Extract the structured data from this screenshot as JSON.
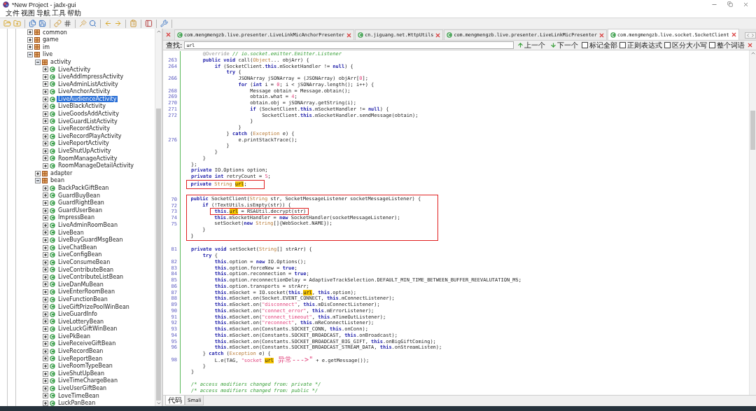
{
  "window": {
    "title": "*New Project - jadx-gui"
  },
  "menu": [
    "文件",
    "视图",
    "导航",
    "工具",
    "帮助"
  ],
  "tree": [
    {
      "label": "common",
      "kind": "package",
      "expanded": false,
      "selected": false
    },
    {
      "label": "game",
      "kind": "package",
      "expanded": false,
      "selected": false
    },
    {
      "label": "im",
      "kind": "package",
      "expanded": false,
      "selected": false
    },
    {
      "label": "live",
      "kind": "package",
      "expanded": true,
      "selected": false,
      "children": [
        {
          "label": "activity",
          "kind": "package",
          "expanded": true,
          "selected": false,
          "children": [
            {
              "label": "LiveActivity",
              "kind": "class",
              "expanded": false,
              "selected": false
            },
            {
              "label": "LiveAddImpressActivity",
              "kind": "class",
              "expanded": false,
              "selected": false
            },
            {
              "label": "LiveAdminListActivity",
              "kind": "class",
              "expanded": false,
              "selected": false
            },
            {
              "label": "LiveAnchorActivity",
              "kind": "class",
              "expanded": false,
              "selected": false
            },
            {
              "label": "LiveAudienceActivity",
              "kind": "class",
              "expanded": false,
              "selected": true
            },
            {
              "label": "LiveBlackActivity",
              "kind": "class",
              "expanded": false,
              "selected": false
            },
            {
              "label": "LiveGoodsAddActivity",
              "kind": "class",
              "expanded": false,
              "selected": false
            },
            {
              "label": "LiveGuardListActivity",
              "kind": "class",
              "expanded": false,
              "selected": false
            },
            {
              "label": "LiveRecordActivity",
              "kind": "class",
              "expanded": false,
              "selected": false
            },
            {
              "label": "LiveRecordPlayActivity",
              "kind": "class",
              "expanded": false,
              "selected": false
            },
            {
              "label": "LiveReportActivity",
              "kind": "class",
              "expanded": false,
              "selected": false
            },
            {
              "label": "LiveShutUpActivity",
              "kind": "class",
              "expanded": false,
              "selected": false
            },
            {
              "label": "RoomManageActivity",
              "kind": "class",
              "expanded": false,
              "selected": false
            },
            {
              "label": "RoomManageDetailActivity",
              "kind": "class",
              "expanded": false,
              "selected": false
            }
          ]
        },
        {
          "label": "adapter",
          "kind": "package",
          "expanded": false,
          "selected": false
        },
        {
          "label": "bean",
          "kind": "package",
          "expanded": true,
          "selected": false,
          "children": [
            {
              "label": "BackPackGiftBean",
              "kind": "class",
              "expanded": false,
              "selected": false
            },
            {
              "label": "GuardBuyBean",
              "kind": "class",
              "expanded": false,
              "selected": false
            },
            {
              "label": "GuardRightBean",
              "kind": "class",
              "expanded": false,
              "selected": false
            },
            {
              "label": "GuardUserBean",
              "kind": "class",
              "expanded": false,
              "selected": false
            },
            {
              "label": "ImpressBean",
              "kind": "class",
              "expanded": false,
              "selected": false
            },
            {
              "label": "LiveAdminRoomBean",
              "kind": "class",
              "expanded": false,
              "selected": false
            },
            {
              "label": "LiveBean",
              "kind": "class",
              "expanded": false,
              "selected": false
            },
            {
              "label": "LiveBuyGuardMsgBean",
              "kind": "class",
              "expanded": false,
              "selected": false
            },
            {
              "label": "LiveChatBean",
              "kind": "class",
              "expanded": false,
              "selected": false
            },
            {
              "label": "LiveConfigBean",
              "kind": "class",
              "expanded": false,
              "selected": false
            },
            {
              "label": "LiveConsumeBean",
              "kind": "class",
              "expanded": false,
              "selected": false
            },
            {
              "label": "LiveContributeBean",
              "kind": "class",
              "expanded": false,
              "selected": false
            },
            {
              "label": "LiveContributeListBean",
              "kind": "class",
              "expanded": false,
              "selected": false
            },
            {
              "label": "LiveDanMuBean",
              "kind": "class",
              "expanded": false,
              "selected": false
            },
            {
              "label": "LiveEnterRoomBean",
              "kind": "class",
              "expanded": false,
              "selected": false
            },
            {
              "label": "LiveFunctionBean",
              "kind": "class",
              "expanded": false,
              "selected": false
            },
            {
              "label": "LiveGiftPrizePoolWinBean",
              "kind": "class",
              "expanded": false,
              "selected": false
            },
            {
              "label": "LiveGuardInfo",
              "kind": "class",
              "expanded": false,
              "selected": false
            },
            {
              "label": "LiveLotteryBean",
              "kind": "class",
              "expanded": false,
              "selected": false
            },
            {
              "label": "LiveLuckGiftWinBean",
              "kind": "class",
              "expanded": false,
              "selected": false
            },
            {
              "label": "LivePkBean",
              "kind": "class",
              "expanded": false,
              "selected": false
            },
            {
              "label": "LiveReceiveGiftBean",
              "kind": "class",
              "expanded": false,
              "selected": false
            },
            {
              "label": "LiveRecordBean",
              "kind": "class",
              "expanded": false,
              "selected": false
            },
            {
              "label": "LiveReportBean",
              "kind": "class",
              "expanded": false,
              "selected": false
            },
            {
              "label": "LiveRoomTypeBean",
              "kind": "class",
              "expanded": false,
              "selected": false
            },
            {
              "label": "LiveShutUpBean",
              "kind": "class",
              "expanded": false,
              "selected": false
            },
            {
              "label": "LiveTimeChargeBean",
              "kind": "class",
              "expanded": false,
              "selected": false
            },
            {
              "label": "LiveUserGiftBean",
              "kind": "class",
              "expanded": false,
              "selected": false
            },
            {
              "label": "LoveTimeBean",
              "kind": "class",
              "expanded": false,
              "selected": false
            },
            {
              "label": "LuckPanBean",
              "kind": "class",
              "expanded": false,
              "selected": false
            }
          ]
        }
      ]
    }
  ],
  "tabs": [
    {
      "label": "com.mengmengzb.live.presenter.LiveLinkMicAnchorPresenter",
      "selected": false
    },
    {
      "label": "cn.jiguang.net.HttpUtils",
      "selected": false
    },
    {
      "label": "com.mengmengzb.live.presenter.LiveLinkMicPresenter",
      "selected": false
    },
    {
      "label": "com.mengmengzb.live.socket.SocketClient",
      "selected": true
    }
  ],
  "search": {
    "label": "查找:",
    "value": "url",
    "previous": "上一个",
    "next": "下一个",
    "options": [
      {
        "label": "标记全部",
        "checked": false
      },
      {
        "label": "正则表达式",
        "checked": false
      },
      {
        "label": "区分大小写",
        "checked": false
      },
      {
        "label": "整个词语",
        "checked": false
      }
    ]
  },
  "code": [
    {
      "boxed": false,
      "lines": [
        {
          "kind": "code",
          "segments": [
            {
              "kind": "annotation",
              "text": "    @Override"
            },
            {
              "kind": "comment",
              "text": " // io.socket.emitter.Emitter.Listener"
            }
          ]
        },
        {
          "kind": "code",
          "number": "263",
          "segments": [
            {
              "kind": "keyword",
              "text": "    public void"
            },
            {
              "kind": "plain",
              "text": " call("
            },
            {
              "kind": "type",
              "text": "Object"
            },
            {
              "kind": "plain",
              "text": "... objArr) {"
            }
          ]
        },
        {
          "kind": "code",
          "number": "264",
          "segments": [
            {
              "kind": "keyword",
              "text": "        if"
            },
            {
              "kind": "plain",
              "text": " (SocketClient."
            },
            {
              "kind": "keyword",
              "text": "this"
            },
            {
              "kind": "plain",
              "text": ".mSocketHandler != "
            },
            {
              "kind": "keyword",
              "text": "null"
            },
            {
              "kind": "plain",
              "text": ") {"
            }
          ]
        },
        {
          "kind": "code",
          "segments": [
            {
              "kind": "keyword",
              "text": "            try"
            },
            {
              "kind": "plain",
              "text": " {"
            }
          ]
        },
        {
          "kind": "code",
          "number": "266",
          "segments": [
            {
              "kind": "plain",
              "text": "                JSONArray jSONArray = (JSONArray) objArr["
            },
            {
              "kind": "number",
              "text": "0"
            },
            {
              "kind": "plain",
              "text": "];"
            }
          ]
        },
        {
          "kind": "code",
          "segments": [
            {
              "kind": "keyword",
              "text": "                for"
            },
            {
              "kind": "plain",
              "text": " ("
            },
            {
              "kind": "keyword",
              "text": "int"
            },
            {
              "kind": "plain",
              "text": " i = "
            },
            {
              "kind": "number",
              "text": "0"
            },
            {
              "kind": "plain",
              "text": "; i < jSONArray.length(); i++) {"
            }
          ]
        },
        {
          "kind": "code",
          "number": "268",
          "segments": [
            {
              "kind": "plain",
              "text": "                    Message obtain = Message.obtain();"
            }
          ]
        },
        {
          "kind": "code",
          "number": "269",
          "segments": [
            {
              "kind": "plain",
              "text": "                    obtain.what = "
            },
            {
              "kind": "number",
              "text": "4"
            },
            {
              "kind": "plain",
              "text": ";"
            }
          ]
        },
        {
          "kind": "code",
          "number": "270",
          "segments": [
            {
              "kind": "plain",
              "text": "                    obtain.obj = jSONArray.getString(i);"
            }
          ]
        },
        {
          "kind": "code",
          "number": "271",
          "segments": [
            {
              "kind": "keyword",
              "text": "                    if"
            },
            {
              "kind": "plain",
              "text": " (SocketClient."
            },
            {
              "kind": "keyword",
              "text": "this"
            },
            {
              "kind": "plain",
              "text": ".mSocketHandler != "
            },
            {
              "kind": "keyword",
              "text": "null"
            },
            {
              "kind": "plain",
              "text": ") {"
            }
          ]
        },
        {
          "kind": "code",
          "number": "272",
          "segments": [
            {
              "kind": "plain",
              "text": "                        SocketClient."
            },
            {
              "kind": "keyword",
              "text": "this"
            },
            {
              "kind": "plain",
              "text": ".mSocketHandler.sendMessage(obtain);"
            }
          ]
        },
        {
          "kind": "code",
          "segments": [
            {
              "kind": "plain",
              "text": "                    }"
            }
          ]
        },
        {
          "kind": "code",
          "segments": [
            {
              "kind": "plain",
              "text": "                }"
            }
          ]
        },
        {
          "kind": "code",
          "segments": [
            {
              "kind": "plain",
              "text": "            } "
            },
            {
              "kind": "keyword",
              "text": "catch"
            },
            {
              "kind": "plain",
              "text": " ("
            },
            {
              "kind": "type",
              "text": "Exception"
            },
            {
              "kind": "plain",
              "text": " e) {"
            }
          ]
        },
        {
          "kind": "code",
          "number": "276",
          "segments": [
            {
              "kind": "plain",
              "text": "                e.printStackTrace();"
            }
          ]
        },
        {
          "kind": "code",
          "segments": [
            {
              "kind": "plain",
              "text": "            }"
            }
          ]
        },
        {
          "kind": "code",
          "segments": [
            {
              "kind": "plain",
              "text": "        }"
            }
          ]
        },
        {
          "kind": "code",
          "segments": [
            {
              "kind": "plain",
              "text": "    }"
            }
          ]
        },
        {
          "kind": "code",
          "segments": [
            {
              "kind": "plain",
              "text": "};"
            }
          ]
        },
        {
          "kind": "code",
          "segments": [
            {
              "kind": "keyword",
              "text": "private"
            },
            {
              "kind": "plain",
              "text": " IO.Options option;"
            }
          ]
        },
        {
          "kind": "code",
          "segments": [
            {
              "kind": "keyword",
              "text": "private int"
            },
            {
              "kind": "plain",
              "text": " retryCount = "
            },
            {
              "kind": "number",
              "text": "5"
            },
            {
              "kind": "plain",
              "text": ";"
            }
          ]
        }
      ]
    },
    {
      "boxed": true,
      "lines": [
        {
          "kind": "code",
          "segments": [
            {
              "kind": "keyword",
              "text": "private "
            },
            {
              "kind": "type",
              "text": "String "
            },
            {
              "kind": "match",
              "text": "url"
            },
            {
              "kind": "plain",
              "text": ";"
            }
          ]
        }
      ]
    },
    {
      "boxed": false,
      "lines": [
        {
          "kind": "blank"
        }
      ]
    },
    {
      "boxed": true,
      "lines": [
        {
          "kind": "code",
          "number": "70",
          "segments": [
            {
              "kind": "keyword",
              "text": "public"
            },
            {
              "kind": "plain",
              "text": " SocketClient("
            },
            {
              "kind": "type",
              "text": "String"
            },
            {
              "kind": "plain",
              "text": " str, SocketMessageListener socketMessageListener) {"
            }
          ]
        },
        {
          "kind": "code",
          "number": "72",
          "segments": [
            {
              "kind": "keyword",
              "text": "    if"
            },
            {
              "kind": "plain",
              "text": " (!TextUtils.isEmpty(str)) {"
            }
          ]
        },
        {
          "kind": "code",
          "number": "73",
          "segments": [
            {
              "kind": "boxed",
              "parts": [
                {
                  "kind": "keyword",
                  "text": "this"
                },
                {
                  "kind": "plain",
                  "text": "."
                },
                {
                  "kind": "match",
                  "text": "url"
                },
                {
                  "kind": "plain",
                  "text": " = RSAUtil.decrypt(str)"
                }
              ]
            }
          ]
        },
        {
          "kind": "code",
          "number": "74",
          "segments": [
            {
              "kind": "keyword",
              "text": "        this"
            },
            {
              "kind": "plain",
              "text": ".mSocketHandler = "
            },
            {
              "kind": "keyword",
              "text": "new"
            },
            {
              "kind": "plain",
              "text": " SocketHandler(socketMessageListener);"
            }
          ]
        },
        {
          "kind": "code",
          "number": "75",
          "segments": [
            {
              "kind": "plain",
              "text": "        setSocket("
            },
            {
              "kind": "keyword",
              "text": "new "
            },
            {
              "kind": "type",
              "text": "String"
            },
            {
              "kind": "plain",
              "text": "[]{WebSocket.NAME});"
            }
          ]
        },
        {
          "kind": "code",
          "segments": [
            {
              "kind": "plain",
              "text": "    }"
            }
          ]
        },
        {
          "kind": "code",
          "segments": [
            {
              "kind": "plain",
              "text": "}"
            }
          ]
        }
      ]
    },
    {
      "boxed": false,
      "lines": [
        {
          "kind": "blank"
        },
        {
          "kind": "code",
          "number": "81",
          "segments": [
            {
              "kind": "keyword",
              "text": "private void"
            },
            {
              "kind": "plain",
              "text": " setSocket("
            },
            {
              "kind": "type",
              "text": "String"
            },
            {
              "kind": "plain",
              "text": "[] strArr) {"
            }
          ]
        },
        {
          "kind": "code",
          "segments": [
            {
              "kind": "keyword",
              "text": "    try"
            },
            {
              "kind": "plain",
              "text": " {"
            }
          ]
        },
        {
          "kind": "code",
          "number": "82",
          "segments": [
            {
              "kind": "keyword",
              "text": "        this"
            },
            {
              "kind": "plain",
              "text": ".option = "
            },
            {
              "kind": "keyword",
              "text": "new"
            },
            {
              "kind": "plain",
              "text": " IO.Options();"
            }
          ]
        },
        {
          "kind": "code",
          "number": "83",
          "segments": [
            {
              "kind": "keyword",
              "text": "        this"
            },
            {
              "kind": "plain",
              "text": ".option.forceNew = "
            },
            {
              "kind": "keyword",
              "text": "true"
            },
            {
              "kind": "plain",
              "text": ";"
            }
          ]
        },
        {
          "kind": "code",
          "number": "84",
          "segments": [
            {
              "kind": "keyword",
              "text": "        this"
            },
            {
              "kind": "plain",
              "text": ".option.reconnection = "
            },
            {
              "kind": "keyword",
              "text": "true"
            },
            {
              "kind": "plain",
              "text": ";"
            }
          ]
        },
        {
          "kind": "code",
          "number": "85",
          "segments": [
            {
              "kind": "keyword",
              "text": "        this"
            },
            {
              "kind": "plain",
              "text": ".option.reconnectionDelay = AdaptiveTrackSelection.DEFAULT_MIN_TIME_BETWEEN_BUFFER_REEVALUTATION_MS;"
            }
          ]
        },
        {
          "kind": "code",
          "number": "86",
          "segments": [
            {
              "kind": "keyword",
              "text": "        this"
            },
            {
              "kind": "plain",
              "text": ".option.transports = strArr;"
            }
          ]
        },
        {
          "kind": "code",
          "number": "87",
          "segments": [
            {
              "kind": "keyword",
              "text": "        this"
            },
            {
              "kind": "plain",
              "text": ".mSocket = IO.socket("
            },
            {
              "kind": "keyword",
              "text": "this"
            },
            {
              "kind": "plain",
              "text": "."
            },
            {
              "kind": "match",
              "text": "url"
            },
            {
              "kind": "plain",
              "text": ", "
            },
            {
              "kind": "keyword",
              "text": "this"
            },
            {
              "kind": "plain",
              "text": ".option);"
            }
          ]
        },
        {
          "kind": "code",
          "number": "88",
          "segments": [
            {
              "kind": "keyword",
              "text": "        this"
            },
            {
              "kind": "plain",
              "text": ".mSocket.on(Socket.EVENT_CONNECT, "
            },
            {
              "kind": "keyword",
              "text": "this"
            },
            {
              "kind": "plain",
              "text": ".mConnectListener);"
            }
          ]
        },
        {
          "kind": "code",
          "number": "89",
          "segments": [
            {
              "kind": "keyword",
              "text": "        this"
            },
            {
              "kind": "plain",
              "text": ".mSocket.on("
            },
            {
              "kind": "string",
              "text": "\"disconnect\""
            },
            {
              "kind": "plain",
              "text": ", "
            },
            {
              "kind": "keyword",
              "text": "this"
            },
            {
              "kind": "plain",
              "text": ".mDisConnectListener);"
            }
          ]
        },
        {
          "kind": "code",
          "number": "90",
          "segments": [
            {
              "kind": "keyword",
              "text": "        this"
            },
            {
              "kind": "plain",
              "text": ".mSocket.on("
            },
            {
              "kind": "string",
              "text": "\"connect_error\""
            },
            {
              "kind": "plain",
              "text": ", "
            },
            {
              "kind": "keyword",
              "text": "this"
            },
            {
              "kind": "plain",
              "text": ".mErrorListener);"
            }
          ]
        },
        {
          "kind": "code",
          "number": "91",
          "segments": [
            {
              "kind": "keyword",
              "text": "        this"
            },
            {
              "kind": "plain",
              "text": ".mSocket.on("
            },
            {
              "kind": "string",
              "text": "\"connect_timeout\""
            },
            {
              "kind": "plain",
              "text": ", "
            },
            {
              "kind": "keyword",
              "text": "this"
            },
            {
              "kind": "plain",
              "text": ".mTimeOutListener);"
            }
          ]
        },
        {
          "kind": "code",
          "number": "92",
          "segments": [
            {
              "kind": "keyword",
              "text": "        this"
            },
            {
              "kind": "plain",
              "text": ".mSocket.on("
            },
            {
              "kind": "string",
              "text": "\"reconnect\""
            },
            {
              "kind": "plain",
              "text": ", "
            },
            {
              "kind": "keyword",
              "text": "this"
            },
            {
              "kind": "plain",
              "text": ".mReConnectListener);"
            }
          ]
        },
        {
          "kind": "code",
          "number": "93",
          "segments": [
            {
              "kind": "keyword",
              "text": "        this"
            },
            {
              "kind": "plain",
              "text": ".mSocket.on(Constants.SOCKET_CONN, "
            },
            {
              "kind": "keyword",
              "text": "this"
            },
            {
              "kind": "plain",
              "text": ".onConn);"
            }
          ]
        },
        {
          "kind": "code",
          "number": "94",
          "segments": [
            {
              "kind": "keyword",
              "text": "        this"
            },
            {
              "kind": "plain",
              "text": ".mSocket.on(Constants.SOCKET_BROADCAST, "
            },
            {
              "kind": "keyword",
              "text": "this"
            },
            {
              "kind": "plain",
              "text": ".onBroadcast);"
            }
          ]
        },
        {
          "kind": "code",
          "number": "95",
          "segments": [
            {
              "kind": "keyword",
              "text": "        this"
            },
            {
              "kind": "plain",
              "text": ".mSocket.on(Constants.SOCKET_BROADCAST_BIG_GIFT, "
            },
            {
              "kind": "keyword",
              "text": "this"
            },
            {
              "kind": "plain",
              "text": ".onBigGiftComing);"
            }
          ]
        },
        {
          "kind": "code",
          "number": "96",
          "segments": [
            {
              "kind": "keyword",
              "text": "        this"
            },
            {
              "kind": "plain",
              "text": ".mSocket.on(Constants.SOCKET_BROADCAST_STREAM_DATA, "
            },
            {
              "kind": "keyword",
              "text": "this"
            },
            {
              "kind": "plain",
              "text": ".onStreamListen);"
            }
          ]
        },
        {
          "kind": "code",
          "segments": [
            {
              "kind": "plain",
              "text": "    } "
            },
            {
              "kind": "keyword",
              "text": "catch"
            },
            {
              "kind": "plain",
              "text": " ("
            },
            {
              "kind": "type",
              "text": "Exception"
            },
            {
              "kind": "plain",
              "text": " e) {"
            }
          ]
        },
        {
          "kind": "code",
          "number": "98",
          "segments": [
            {
              "kind": "plain",
              "text": "        L.e(TAG, "
            },
            {
              "kind": "string",
              "text": "\"socket "
            },
            {
              "kind": "match",
              "text": "url"
            },
            {
              "kind": "cjk_string",
              "text": " 异常--->\""
            },
            {
              "kind": "plain",
              "text": " + e.getMessage());"
            }
          ]
        },
        {
          "kind": "code",
          "segments": [
            {
              "kind": "plain",
              "text": "    }"
            }
          ]
        },
        {
          "kind": "code",
          "segments": [
            {
              "kind": "plain",
              "text": "}"
            }
          ]
        },
        {
          "kind": "blank"
        },
        {
          "kind": "code",
          "segments": [
            {
              "kind": "comment",
              "text": "/* access modifiers changed from: private */"
            }
          ]
        },
        {
          "kind": "code",
          "segments": [
            {
              "kind": "comment",
              "text": "/* access modifiers changed from: public */"
            }
          ]
        }
      ]
    }
  ],
  "bottom_tabs": [
    {
      "label": "代码",
      "selected": true
    },
    {
      "label": "Smali",
      "selected": false
    }
  ]
}
